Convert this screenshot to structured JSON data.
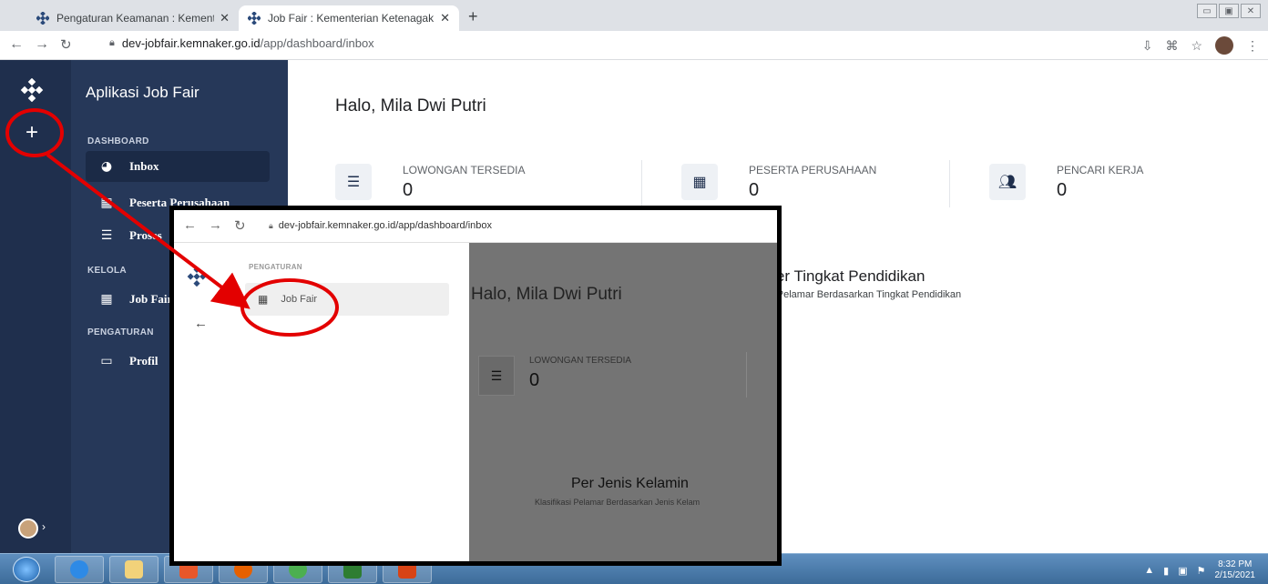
{
  "browser": {
    "tabs": [
      {
        "title": "Pengaturan Keamanan : Kemente",
        "close": "✕"
      },
      {
        "title": "Job Fair : Kementerian Ketenagak",
        "close": "✕"
      }
    ],
    "new_tab": "+",
    "url_host": "dev-jobfair.kemnaker.go.id",
    "url_path": "/app/dashboard/inbox"
  },
  "app": {
    "title": "Aplikasi Job Fair",
    "plus": "+"
  },
  "sidebar": {
    "sections": {
      "dashboard": "DASHBOARD",
      "kelola": "KELOLA",
      "pengaturan": "PENGATURAN"
    },
    "items": [
      {
        "label": "Inbox",
        "icon": "pie-chart-icon"
      },
      {
        "label": "Peserta Perusahaan",
        "icon": "building-icon"
      },
      {
        "label": "Proses",
        "icon": "checklist-icon"
      },
      {
        "label": "Job Fair",
        "icon": "calendar-icon"
      },
      {
        "label": "Profil",
        "icon": "id-card-icon"
      }
    ]
  },
  "main": {
    "greeting": "Halo, Mila Dwi Putri",
    "stats": [
      {
        "label": "LOWONGAN TERSEDIA",
        "value": "0",
        "icon": "list-icon"
      },
      {
        "label": "PESERTA PERUSAHAAN",
        "value": "0",
        "icon": "building-icon"
      },
      {
        "label": "PENCARI KERJA",
        "value": "0",
        "icon": "users-icon"
      }
    ],
    "chart_title": "Per Tingkat Pendidikan",
    "chart_subtitle": "Klasifikasi Pelamar Berdasarkan Tingkat Pendidikan"
  },
  "inset": {
    "url": "dev-jobfair.kemnaker.go.id/app/dashboard/inbox",
    "section": "PENGATURAN",
    "item": "Job Fair",
    "greeting": "Halo, Mila Dwi Putri",
    "stat_label": "LOWONGAN TERSEDIA",
    "stat_value": "0",
    "chart_title": "Per Jenis Kelamin",
    "chart_subtitle": "Klasifikasi Pelamar Berdasarkan Jenis Kelam"
  },
  "taskbar": {
    "time": "8:32 PM",
    "date": "2/15/2021"
  },
  "colors": {
    "rail": "#1f2f4d",
    "sidebar": "#263859",
    "annotation": "#e30000"
  }
}
